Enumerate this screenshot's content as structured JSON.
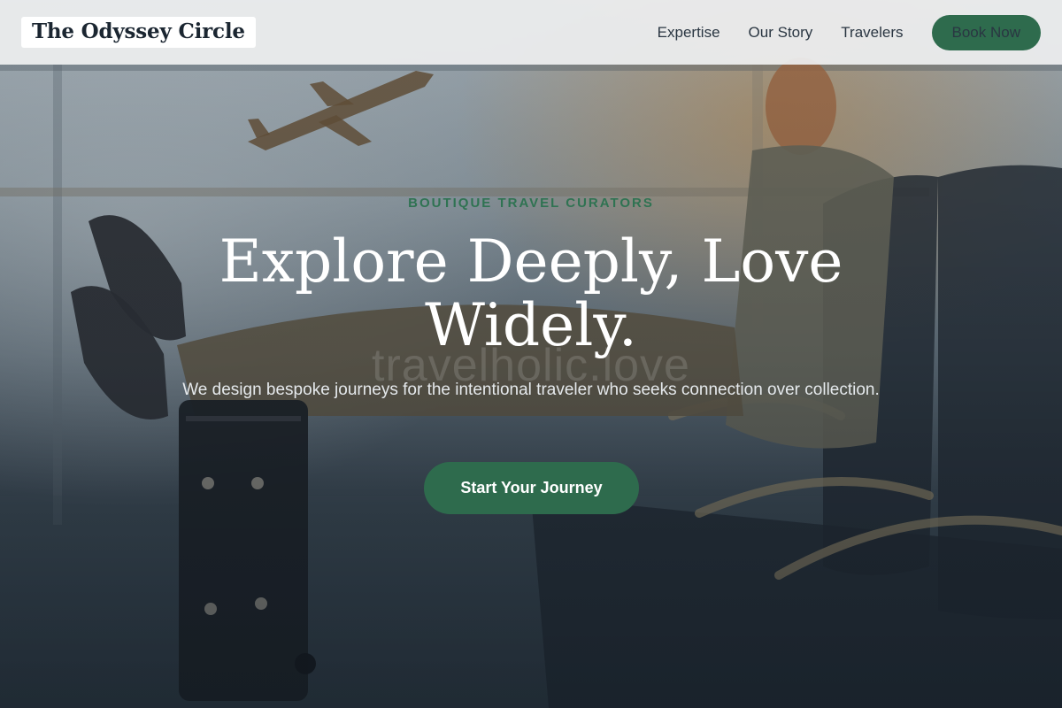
{
  "brand": {
    "name": "The Odyssey Circle"
  },
  "nav": {
    "items": [
      {
        "label": "Expertise"
      },
      {
        "label": "Our Story"
      },
      {
        "label": "Travelers"
      }
    ],
    "cta_label": "Book Now"
  },
  "hero": {
    "eyebrow": "BOUTIQUE TRAVEL CURATORS",
    "headline_line1": "Explore Deeply, Love",
    "headline_line2": "Widely.",
    "watermark": "travelholic.love",
    "subtitle": "We design bespoke journeys for the intentional traveler who seeks connection over collection.",
    "cta_label": "Start Your Journey"
  },
  "colors": {
    "accent": "#2e6b4d",
    "eyebrow": "#2f7352",
    "header_bg": "#ecedee",
    "text_dark": "#1b2631"
  }
}
